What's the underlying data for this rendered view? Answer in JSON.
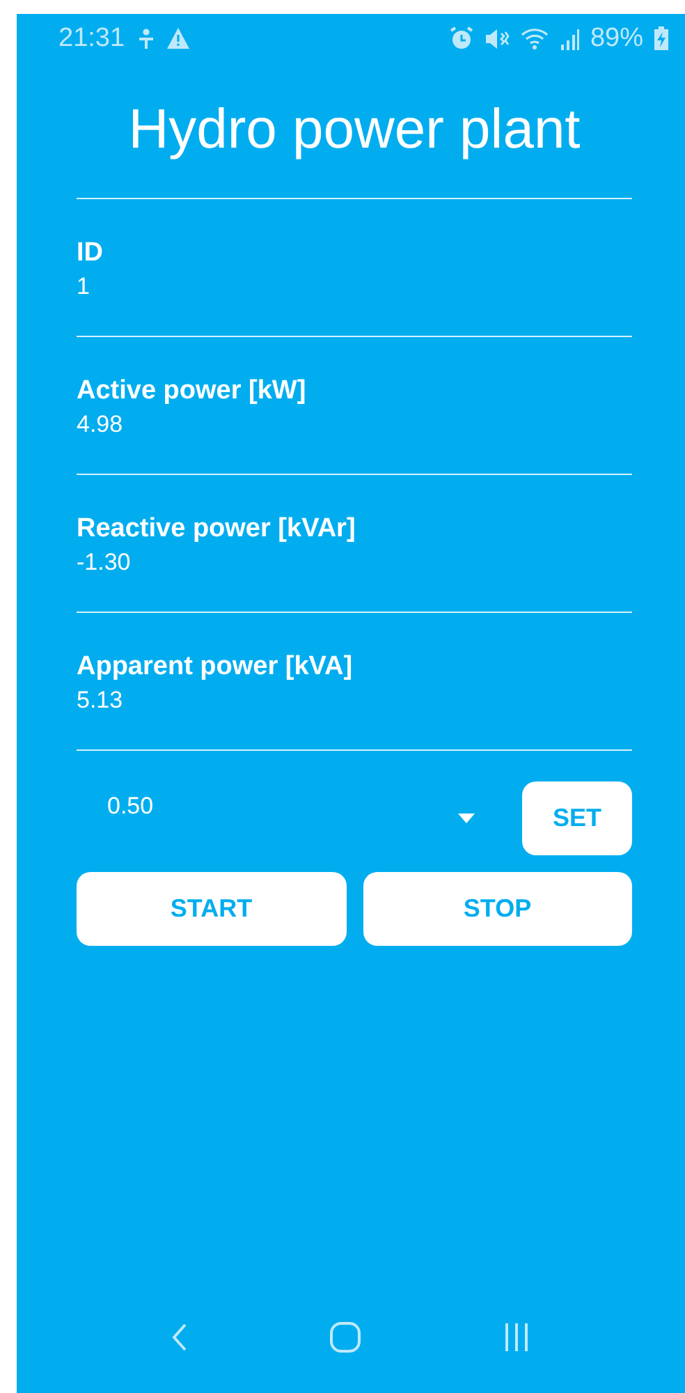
{
  "status_bar": {
    "time": "21:31",
    "battery": "89%"
  },
  "title": "Hydro power plant",
  "fields": [
    {
      "label": "ID",
      "value": "1"
    },
    {
      "label": "Active power [kW]",
      "value": "4.98"
    },
    {
      "label": "Reactive power [kVAr]",
      "value": "-1.30"
    },
    {
      "label": "Apparent power [kVA]",
      "value": "5.13"
    }
  ],
  "dropdown": {
    "value": "0.50"
  },
  "set_button": "SET",
  "buttons": [
    "START",
    "STOP"
  ]
}
